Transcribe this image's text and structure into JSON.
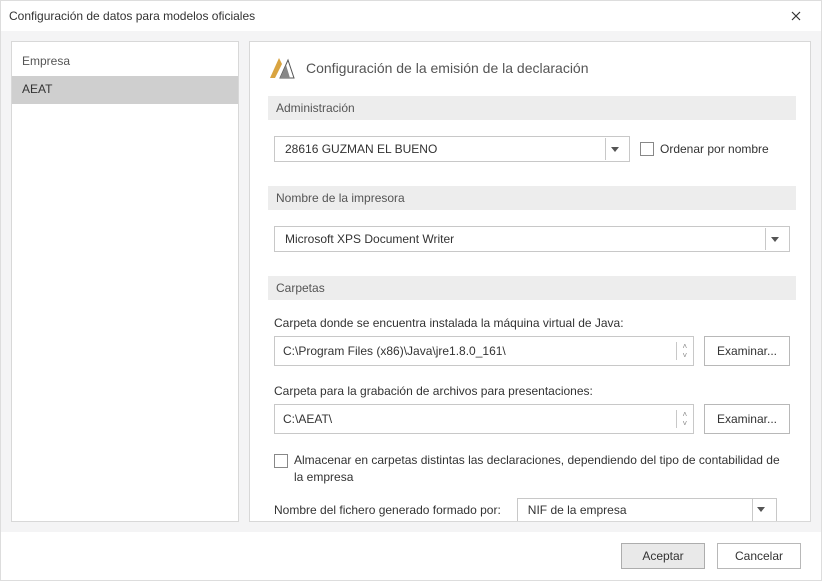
{
  "window": {
    "title": "Configuración de datos para modelos oficiales"
  },
  "sidebar": {
    "items": [
      {
        "label": "Empresa"
      },
      {
        "label": "AEAT"
      }
    ],
    "selected_index": 1
  },
  "page": {
    "title": "Configuración de la emisión de la declaración"
  },
  "sections": {
    "admin": {
      "heading": "Administración",
      "value": "28616 GUZMAN EL BUENO",
      "order_by_name_label": "Ordenar por nombre"
    },
    "printer": {
      "heading": "Nombre de la impresora",
      "value": "Microsoft XPS Document Writer"
    },
    "folders": {
      "heading": "Carpetas",
      "java_label": "Carpeta donde se encuentra instalada la máquina virtual de Java:",
      "java_path": "C:\\Program Files (x86)\\Java\\jre1.8.0_161\\",
      "pres_label": "Carpeta para la grabación de archivos para presentaciones:",
      "pres_path": "C:\\AEAT\\",
      "browse_label": "Examinar...",
      "store_sep_label": "Almacenar en carpetas distintas las declaraciones, dependiendo del tipo de contabilidad de la empresa",
      "gen_name_label": "Nombre del fichero generado formado por:",
      "gen_name_value": "NIF de la empresa"
    }
  },
  "footer": {
    "accept_label": "Aceptar",
    "cancel_label": "Cancelar"
  }
}
